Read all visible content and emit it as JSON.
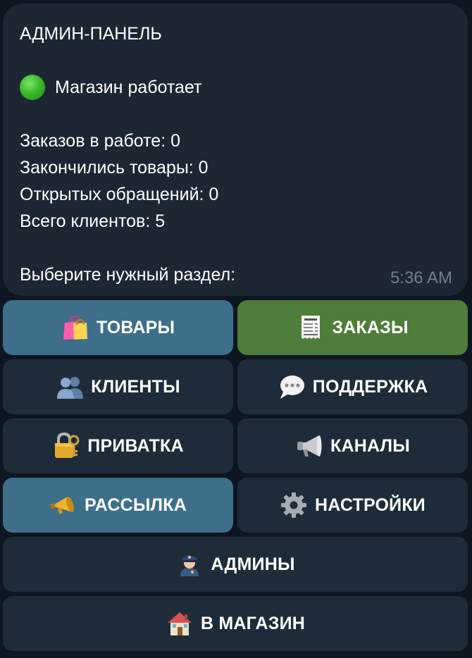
{
  "message": {
    "title": "АДМИН-ПАНЕЛЬ",
    "status": "Магазин работает",
    "status_color": "#3cba2c",
    "stats": [
      "Заказов в работе: 0",
      "Закончились товары: 0",
      "Открытых обращений: 0",
      "Всего клиентов: 5"
    ],
    "prompt": "Выберите нужный раздел:",
    "time": "5:36 AM"
  },
  "keyboard": {
    "rows": [
      [
        {
          "label": "ТОВАРЫ",
          "icon": "shopping-bags-icon",
          "color": "#3d6f8b"
        },
        {
          "label": "ЗАКАЗЫ",
          "icon": "receipt-icon",
          "color": "#4f7d3a"
        }
      ],
      [
        {
          "label": "КЛИЕНТЫ",
          "icon": "people-icon"
        },
        {
          "label": "ПОДДЕРЖКА",
          "icon": "speech-bubble-icon"
        }
      ],
      [
        {
          "label": "ПРИВАТКА",
          "icon": "lock-key-icon"
        },
        {
          "label": "КАНАЛЫ",
          "icon": "loudspeaker-icon"
        }
      ],
      [
        {
          "label": "РАССЫЛКА",
          "icon": "megaphone-icon",
          "color": "#3d6f8b"
        },
        {
          "label": "НАСТРОЙКИ",
          "icon": "gear-icon"
        }
      ],
      [
        {
          "label": "АДМИНЫ",
          "icon": "police-officer-icon"
        }
      ],
      [
        {
          "label": "В МАГАЗИН",
          "icon": "house-icon"
        }
      ]
    ]
  }
}
